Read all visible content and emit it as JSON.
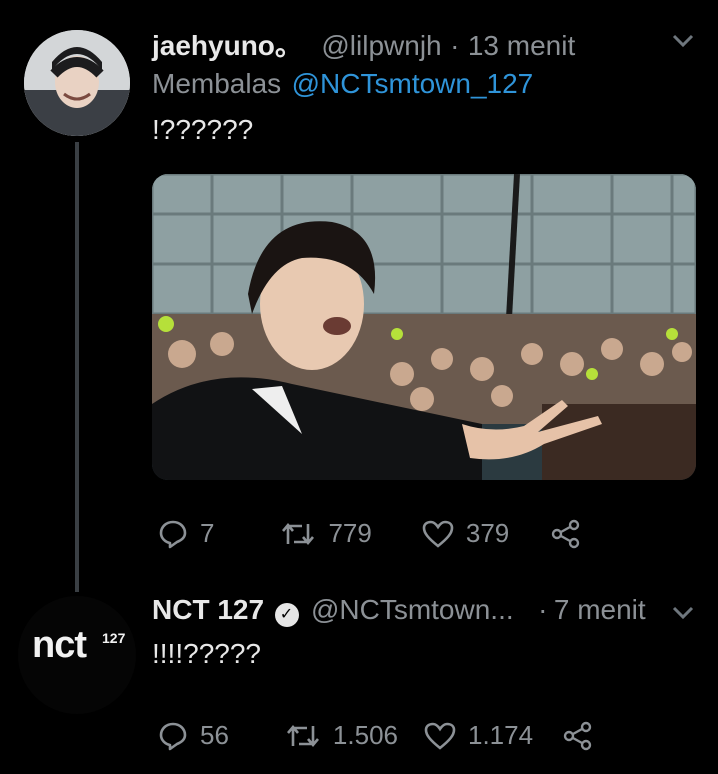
{
  "tweet1": {
    "display_name": "jaehyuno。",
    "handle": "@lilpwnjh",
    "separator": "·",
    "time": "13 menit",
    "reply_prefix": "Membalas",
    "reply_to": "@NCTsmtown_127",
    "text": "!??????",
    "stats": {
      "replies": "7",
      "retweets": "779",
      "likes": "379"
    }
  },
  "tweet2": {
    "display_name": "NCT 127",
    "handle": "@NCTsmtown...",
    "separator": "·",
    "time": "7 menit",
    "text": "!!!!?????",
    "avatar_text": "nct",
    "avatar_sup": "127",
    "stats": {
      "replies": "56",
      "retweets": "1.506",
      "likes": "1.174"
    }
  },
  "colors": {
    "background": "#000000",
    "link": "#2f94d9",
    "muted": "#8c9196"
  },
  "icons": [
    "reply-icon",
    "retweet-icon",
    "like-icon",
    "share-icon",
    "chevron-down-icon",
    "verified-badge-icon"
  ]
}
